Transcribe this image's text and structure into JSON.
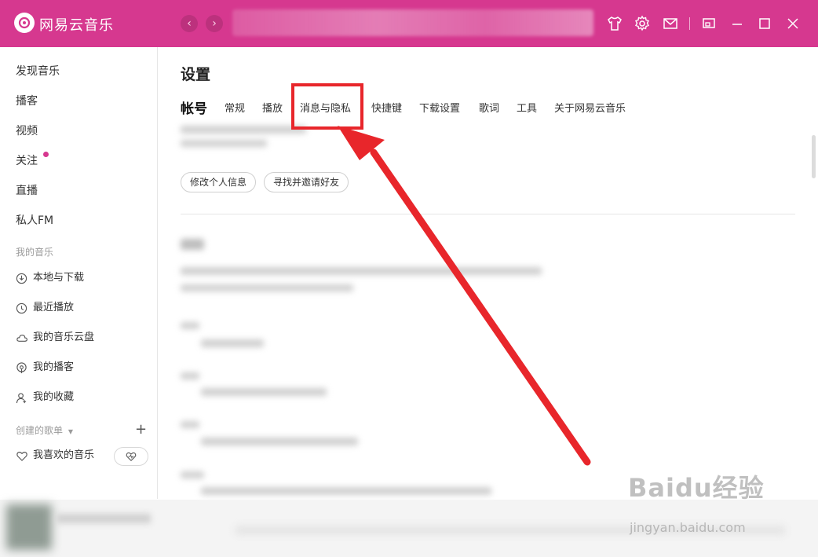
{
  "app": {
    "brand": "网易云音乐"
  },
  "colors": {
    "brand": "#d6388f",
    "highlight": "#e8262b"
  },
  "titlebar": {
    "back_icon": "chevron-left-icon",
    "forward_icon": "chevron-right-icon",
    "icons": [
      "shirt-icon",
      "gear-icon",
      "mail-icon",
      "mini-mode-icon",
      "minimize-icon",
      "maximize-icon",
      "close-icon"
    ]
  },
  "sidebar": {
    "main_items": [
      "发现音乐",
      "播客",
      "视频",
      "关注",
      "直播",
      "私人FM"
    ],
    "my_music_header": "我的音乐",
    "my_music": [
      {
        "label": "本地与下载",
        "icon": "download-icon"
      },
      {
        "label": "最近播放",
        "icon": "clock-icon"
      },
      {
        "label": "我的音乐云盘",
        "icon": "cloud-icon"
      },
      {
        "label": "我的播客",
        "icon": "podcast-icon"
      },
      {
        "label": "我的收藏",
        "icon": "user-icon"
      }
    ],
    "playlist_header": "创建的歌单",
    "favorite_playlist": "我喜欢的音乐"
  },
  "settings": {
    "title": "设置",
    "tabs": [
      "帐号",
      "常规",
      "播放",
      "消息与隐私",
      "快捷键",
      "下载设置",
      "歌词",
      "工具",
      "关于网易云音乐"
    ],
    "active_tab": "帐号",
    "highlighted_tab": "消息与隐私",
    "buttons": {
      "edit_profile": "修改个人信息",
      "find_friends": "寻找并邀请好友"
    }
  },
  "watermark": {
    "main": "Baidu经验",
    "sub": "jingyan.baidu.com"
  }
}
